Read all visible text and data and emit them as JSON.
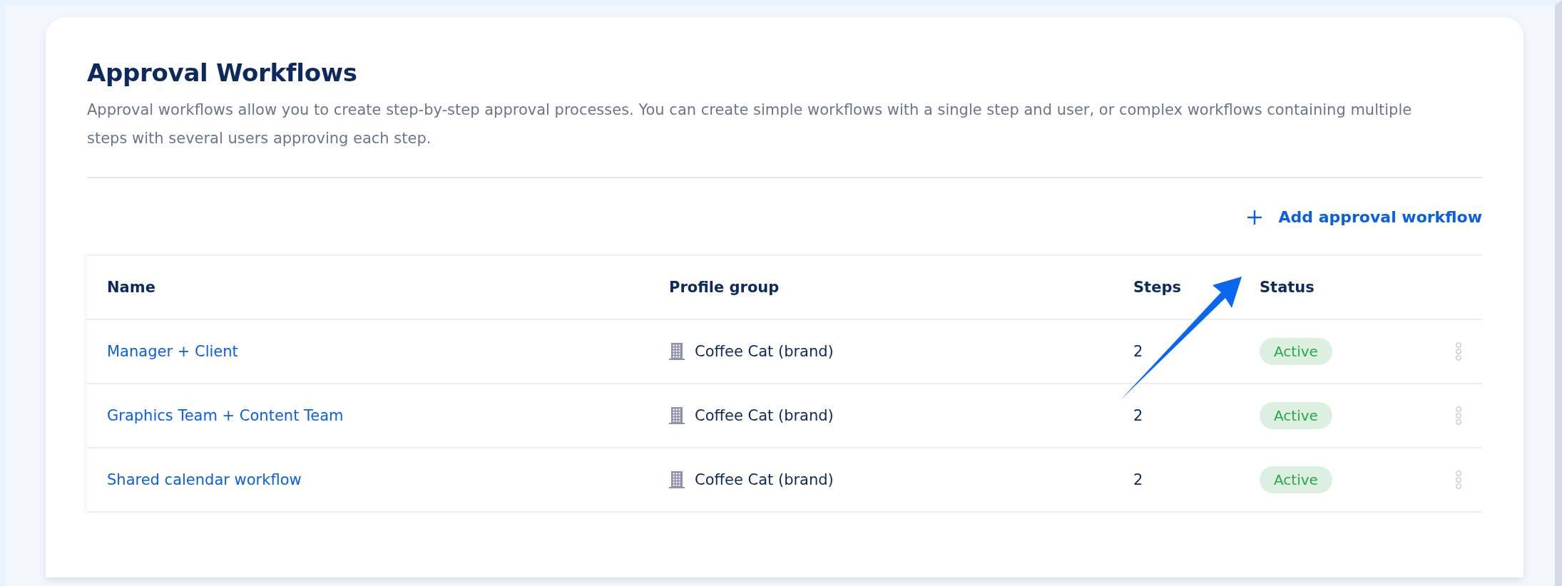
{
  "page": {
    "title": "Approval Workflows",
    "description": "Approval workflows allow you to create step-by-step approval processes. You can create simple workflows with a single step and user, or complex workflows containing multiple steps with several users approving each step."
  },
  "add_button": {
    "label": "Add approval workflow"
  },
  "table": {
    "columns": [
      "Name",
      "Profile group",
      "Steps",
      "Status"
    ],
    "rows": [
      {
        "name": "Manager + Client",
        "profile_group": "Coffee Cat (brand)",
        "steps": "2",
        "status": {
          "label": "Active",
          "kind": "active"
        }
      },
      {
        "name": "Graphics Team + Content Team",
        "profile_group": "Coffee Cat (brand)",
        "steps": "2",
        "status": {
          "label": "Active",
          "kind": "active"
        }
      },
      {
        "name": "Shared calendar workflow",
        "profile_group": "Coffee Cat (brand)",
        "steps": "2",
        "status": {
          "label": "Active",
          "kind": "active"
        }
      }
    ]
  }
}
